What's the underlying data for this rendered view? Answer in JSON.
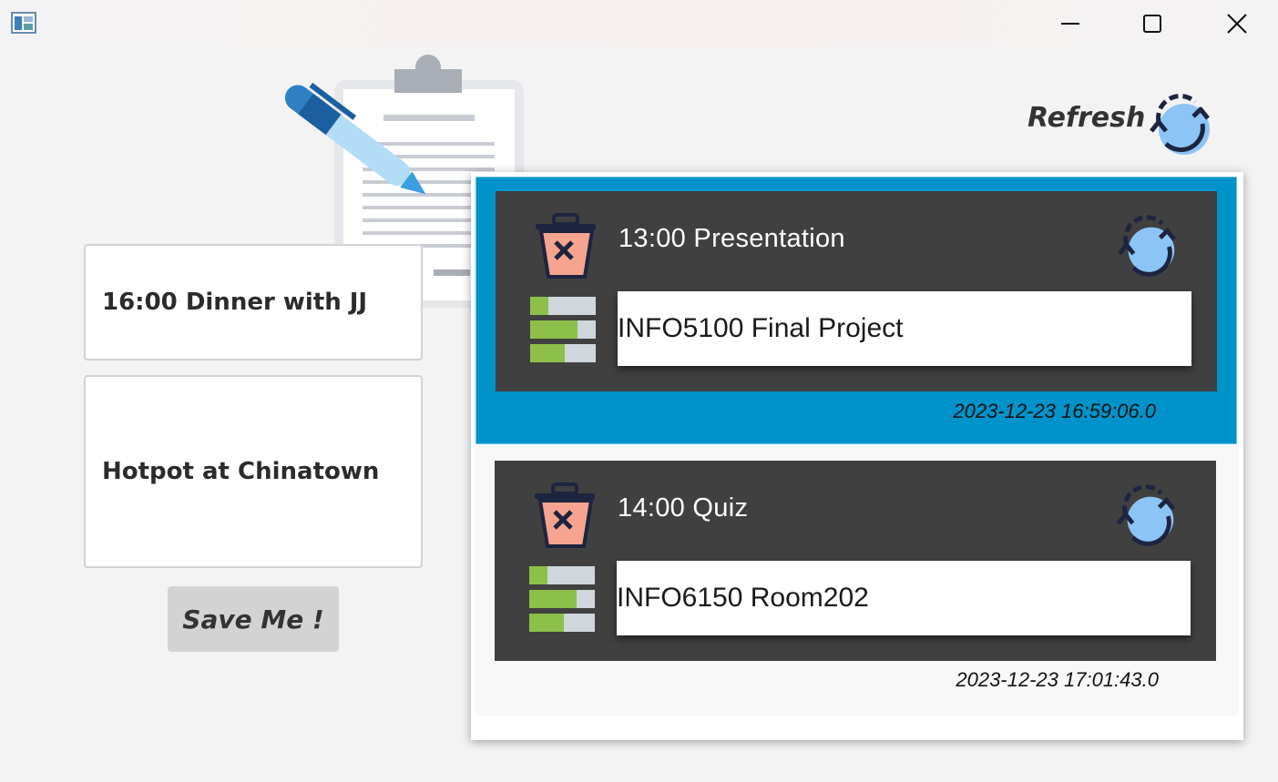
{
  "window": {
    "title": "",
    "controls": {
      "minimize": "minimize-icon",
      "maximize": "maximize-icon",
      "close": "close-icon"
    }
  },
  "form": {
    "title_value": "16:00 Dinner with JJ",
    "body_value": "Hotpot at Chinatown",
    "save_label": "Save Me !"
  },
  "toolbar": {
    "refresh_label": "Refresh"
  },
  "notes": [
    {
      "title": "13:00 Presentation",
      "description": "INFO5100 Final Project",
      "timestamp": "2023-12-23 16:59:06.0",
      "selected": true
    },
    {
      "title": "14:00 Quiz",
      "description": "INFO6150 Room202",
      "timestamp": "2023-12-23 17:01:43.0",
      "selected": false
    }
  ],
  "colors": {
    "selection": "#0093c9",
    "card": "#404040",
    "accent_blue": "#8cc4f5",
    "trash_fill": "#f6a48f",
    "progress_green": "#8dc04a"
  }
}
